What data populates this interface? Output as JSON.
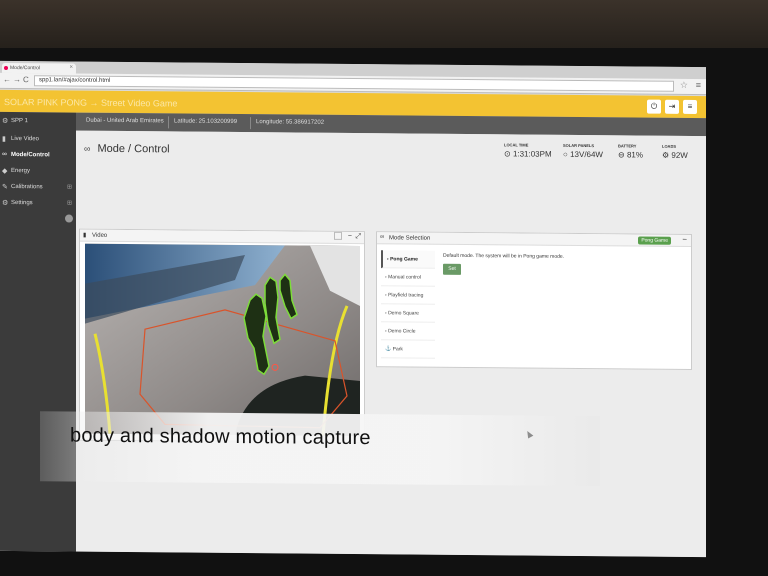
{
  "browser": {
    "tab_title": "Mode/Control",
    "tab_close": "×",
    "url": "spp1.lan/#ajax/control.html",
    "nav_back": "←",
    "nav_forward": "→",
    "nav_reload": "C",
    "star": "☆",
    "menu": "≡"
  },
  "header": {
    "brand": "SOLAR PINK PONG → Street Video Game",
    "power_icon": "⏻",
    "expand_icon": "⇥",
    "menu_icon": "≡"
  },
  "sidebar": {
    "device": "SPP 1",
    "items": [
      {
        "label": "Live Video",
        "icon": "video-icon",
        "glyph": "▮"
      },
      {
        "label": "Mode/Control",
        "icon": "gamepad-icon",
        "glyph": "∞"
      },
      {
        "label": "Energy",
        "icon": "leaf-icon",
        "glyph": "◆"
      },
      {
        "label": "Calibrations",
        "icon": "wrench-icon",
        "glyph": "✎"
      },
      {
        "label": "Settings",
        "icon": "gear-icon",
        "glyph": "⚙"
      }
    ]
  },
  "location": {
    "place": "Dubai - United Arab Emirates",
    "latitude": "Latitude: 25.103200999",
    "longitude": "Longitude: 55.386917202"
  },
  "page": {
    "title": "Mode / Control"
  },
  "stats": [
    {
      "label": "LOCAL TIME",
      "value": "1:31:03PM",
      "icon": "⊙"
    },
    {
      "label": "SOLAR PANELS",
      "value": "13V/64W",
      "icon": "○"
    },
    {
      "label": "BATTERY",
      "value": "81%",
      "icon": "⊖"
    },
    {
      "label": "LOADS",
      "value": "92W",
      "icon": "⚙"
    }
  ],
  "video_panel": {
    "title": "Video",
    "minimize": "−",
    "fullscreen": "⤢"
  },
  "mode_panel": {
    "title": "Mode Selection",
    "badge": "Pong Game",
    "collapse": "−",
    "modes": [
      "Pong Game",
      "Manual control",
      "Playfield tracing",
      "Demo Square",
      "Demo Circle",
      "Park"
    ],
    "description": "Default mode. The system will be in Pong game mode.",
    "set_button": "Set"
  },
  "caption": "body and shadow motion capture",
  "colors": {
    "header": "#f3c332",
    "sidebar": "#3b3b3b",
    "badge": "#5aa04d",
    "tracking_outline": "#7ddc3a",
    "playfield_line": "#e8e031",
    "boundary": "#d9542b"
  }
}
